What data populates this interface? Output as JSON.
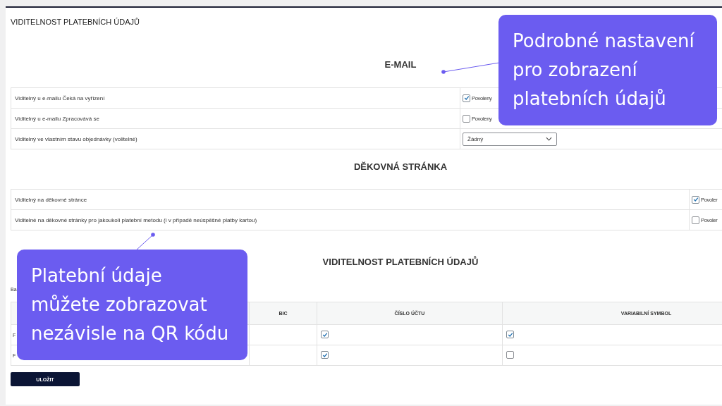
{
  "page_title": "VIDITELNOST PLATEBNÍCH ÚDAJŮ",
  "sections": [
    {
      "heading": "E-MAIL",
      "rows": [
        {
          "label": "Viditelný u e-mailu Čeká na vyřízení",
          "kind": "checkbox",
          "checked": true,
          "option": "Povoleny"
        },
        {
          "label": "Viditelný u e-mailu Zpracovává se",
          "kind": "checkbox",
          "checked": false,
          "option": "Povoleny"
        },
        {
          "label": "Viditelný ve vlastním stavu objednávky (volitelné)",
          "kind": "select",
          "value": "Žádný"
        }
      ]
    },
    {
      "heading": "DĚKOVNÁ STRÁNKA",
      "rows": [
        {
          "label": "Viditelný na děkovné stránce",
          "kind": "checkbox",
          "checked": true,
          "option": "Povoler"
        },
        {
          "label": "Viditelné na děkovné stránky pro jakoukoli platební metodu (i v případě neúspěšné platby kartou)",
          "kind": "checkbox",
          "checked": false,
          "option": "Povoler"
        }
      ]
    }
  ],
  "payment_table": {
    "heading": "VIDITELNOST PLATEBNÍCH ÚDAJŮ",
    "label": "Ba",
    "columns": [
      "BIC",
      "ČÍSLO ÚČTU",
      "VARIABILNÍ SYMBOL"
    ],
    "rows": [
      {
        "label": "F",
        "account_number": {
          "checked": true
        },
        "variable_symbol": {
          "checked": true
        }
      },
      {
        "label": "F",
        "account_number": {
          "checked": true
        },
        "variable_symbol": {
          "checked": false
        }
      }
    ]
  },
  "save_button": "ULOŽIT",
  "callouts": [
    {
      "text": "Podrobné nastavení pro zobrazení platebních údajů"
    },
    {
      "text": "Platební údaje můžete zobrazovat nezávisle na QR kódu"
    }
  ]
}
